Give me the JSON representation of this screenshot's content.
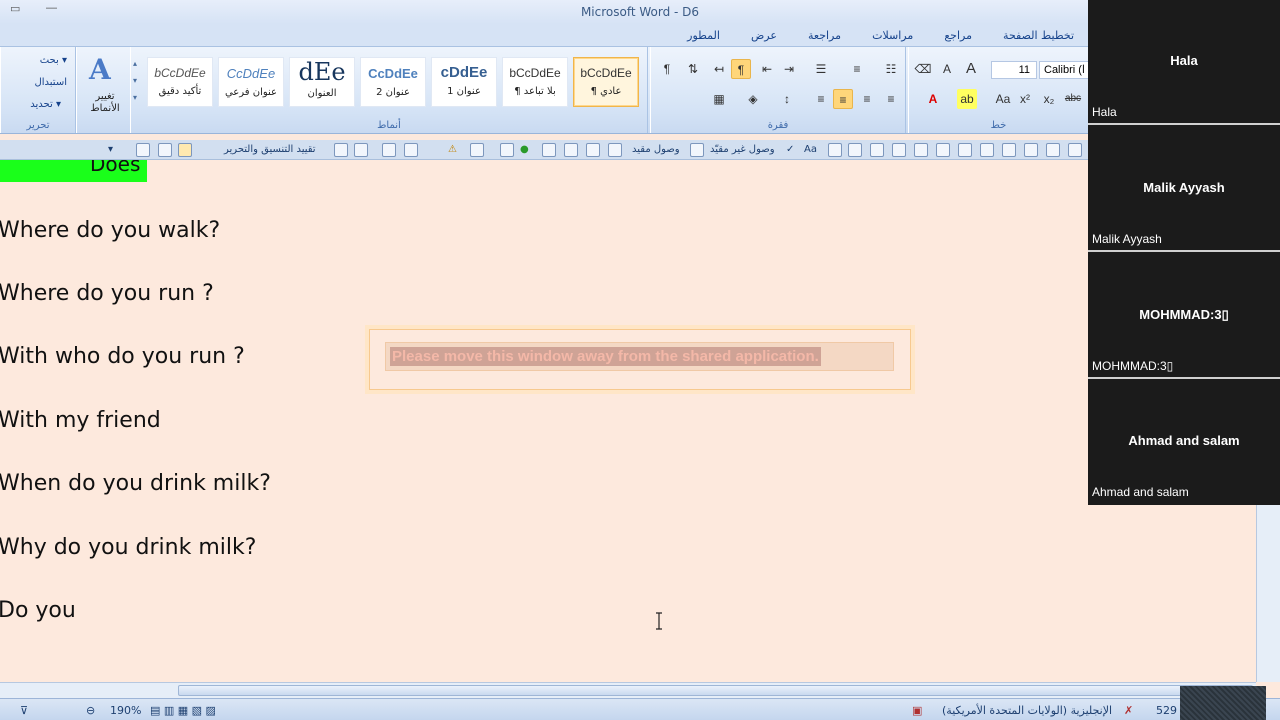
{
  "window": {
    "title": "Microsoft Word - D6"
  },
  "ribbon_tabs": [
    "تخطيط الصفحة",
    "مراجع",
    "مراسلات",
    "مراجعة",
    "عرض",
    "المطور"
  ],
  "ribbon": {
    "edit_group": {
      "find": "بحث",
      "replace": "استبدال",
      "select": "تحديد",
      "label": "تحرير"
    },
    "change_styles": "تغيير الأنماط",
    "styles_label": "أنماط",
    "styles": [
      {
        "sample": "bCcDdEe",
        "name": "تأكيد دقيق"
      },
      {
        "sample": "CcDdEe",
        "name": "عنوان فرعي"
      },
      {
        "sample": "dEe",
        "name": "العنوان"
      },
      {
        "sample": "CcDdEe",
        "name": "عنوان 2"
      },
      {
        "sample": "cDdEe",
        "name": "عنوان 1"
      },
      {
        "sample": "bCcDdEe",
        "name": "¶ بلا تباعد"
      },
      {
        "sample": "bCcDdEe",
        "name": "¶ عادي"
      }
    ],
    "paragraph_label": "فقرة",
    "font_label": "خط",
    "font_size": "11",
    "font_name": "Calibri (ا"
  },
  "toolbar2": {
    "restrict": "تقييد التنسيق والتحرير",
    "restricted_access": "وصول مقيد",
    "unrestricted_access": "وصول غير مقيّد"
  },
  "document": {
    "highlight_text": "Does",
    "lines": [
      "Where do you walk?",
      "Where do you run ?",
      "With who do you run ?",
      "With my friend",
      "When do you drink milk?",
      "Why do you drink milk?",
      "Do you"
    ]
  },
  "notice": {
    "text": "Please move this window away from the shared application."
  },
  "status": {
    "zoom": "190%",
    "language": "الإنجليزية (الولايات المتحدة الأمريكية)",
    "words": "529"
  },
  "participants": [
    {
      "center": "Hala",
      "foot": "Hala"
    },
    {
      "center": "Malik Ayyash",
      "foot": "Malik Ayyash"
    },
    {
      "center": "MOHMMAD:3▯",
      "foot": "MOHMMAD:3▯"
    },
    {
      "center": "Ahmad and salam",
      "foot": "Ahmad and salam"
    }
  ]
}
